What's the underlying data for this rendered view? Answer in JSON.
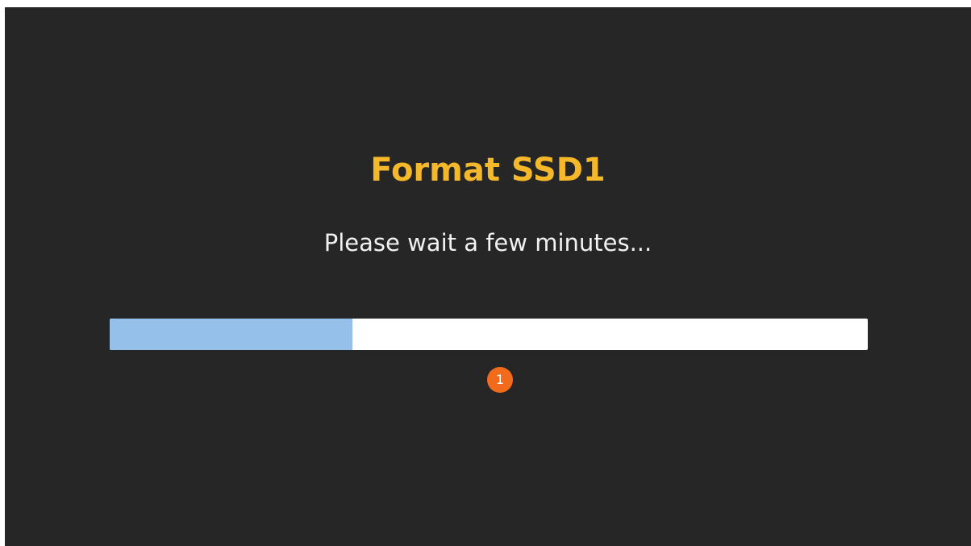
{
  "dialog": {
    "title": "Format SSD1",
    "message": "Please wait a few minutes..."
  },
  "progress": {
    "fraction": 0.32,
    "fill_color": "#94c0ea",
    "track_color": "#ffffff"
  },
  "annotation": {
    "badge": "1",
    "color": "#f26a1b"
  },
  "colors": {
    "background": "#262626",
    "title": "#f5b82b",
    "text": "#f2f2f2"
  }
}
